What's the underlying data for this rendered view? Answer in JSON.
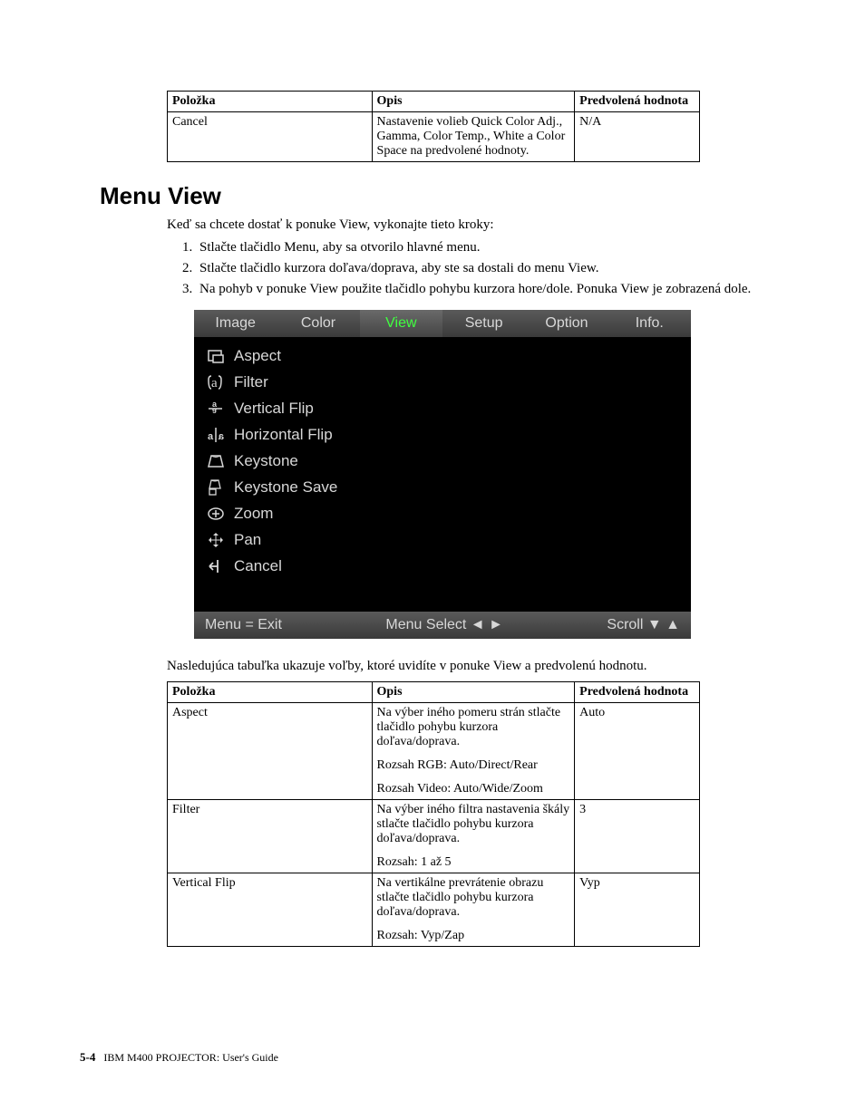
{
  "table1": {
    "headers": [
      "Položka",
      "Opis",
      "Predvolená hodnota"
    ],
    "rows": [
      {
        "item": "Cancel",
        "desc": "Nastavenie volieb Quick Color Adj., Gamma, Color Temp., White a Color Space na predvolené hodnoty.",
        "def": "N/A"
      }
    ]
  },
  "heading": "Menu View",
  "intro": "Keď sa chcete dostať k ponuke View, vykonajte tieto kroky:",
  "steps": [
    "Stlačte tlačidlo Menu, aby sa otvorilo hlavné menu.",
    "Stlačte tlačidlo kurzora doľava/doprava, aby ste sa dostali do menu View.",
    "Na pohyb v ponuke View použite tlačidlo pohybu kurzora hore/dole. Ponuka View je zobrazená dole."
  ],
  "osd": {
    "tabs": [
      "Image",
      "Color",
      "View",
      "Setup",
      "Option",
      "Info."
    ],
    "active_tab": "View",
    "items": [
      "Aspect",
      "Filter",
      "Vertical Flip",
      "Horizontal Flip",
      "Keystone",
      "Keystone Save",
      "Zoom",
      "Pan",
      "Cancel"
    ],
    "status": {
      "left": "Menu = Exit",
      "mid": "Menu Select ◄ ►",
      "right": "Scroll ▼ ▲"
    }
  },
  "para2": "Nasledujúca tabuľka ukazuje voľby, ktoré uvidíte v ponuke View a predvolenú hodnotu.",
  "table2": {
    "headers": [
      "Položka",
      "Opis",
      "Predvolená hodnota"
    ],
    "rows": [
      {
        "item": "Aspect",
        "desc": [
          "Na výber iného pomeru strán stlačte tlačidlo pohybu kurzora doľava/doprava.",
          "Rozsah RGB: Auto/Direct/Rear",
          "Rozsah Video: Auto/Wide/Zoom"
        ],
        "def": "Auto"
      },
      {
        "item": "Filter",
        "desc": [
          "Na výber iného filtra nastavenia škály stlačte tlačidlo pohybu kurzora doľava/doprava.",
          "Rozsah: 1 až 5"
        ],
        "def": "3"
      },
      {
        "item": "Vertical Flip",
        "desc": [
          "Na vertikálne prevrátenie obrazu stlačte tlačidlo pohybu kurzora doľava/doprava.",
          "Rozsah: Vyp/Zap"
        ],
        "def": "Vyp"
      }
    ]
  },
  "footer": {
    "page": "5-4",
    "title": "IBM M400 PROJECTOR: User's Guide"
  }
}
